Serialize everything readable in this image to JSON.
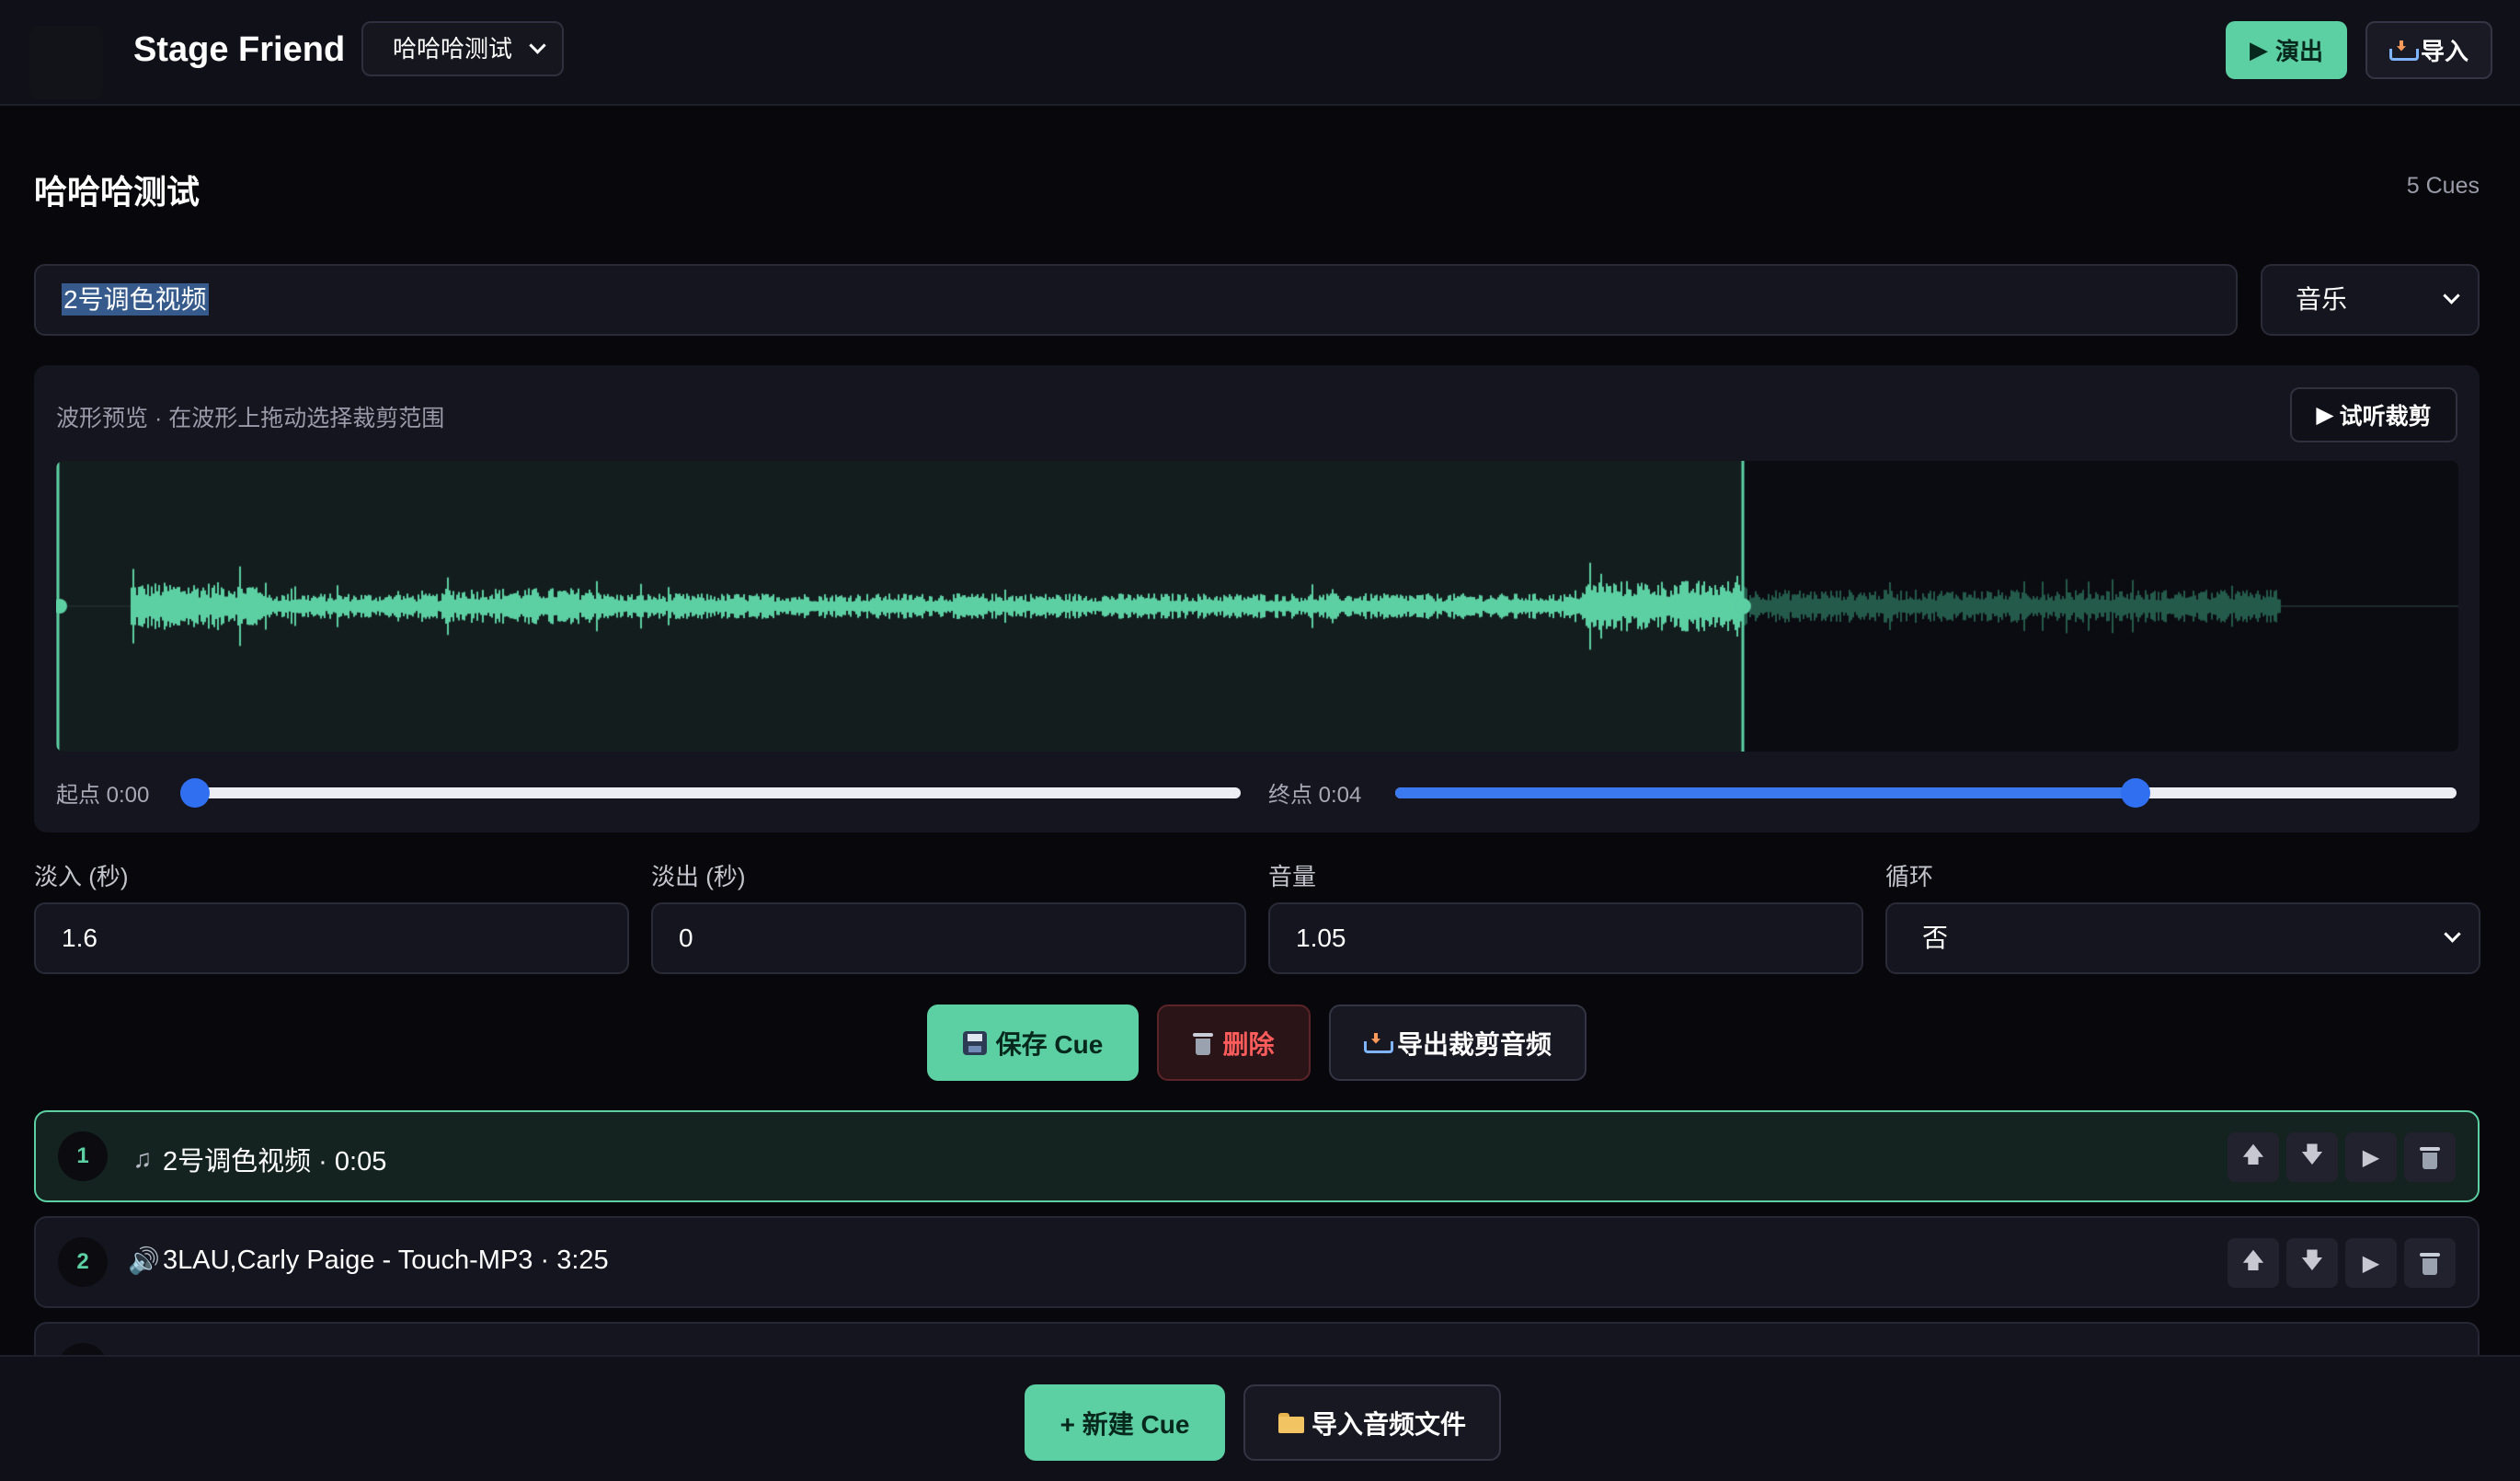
{
  "header": {
    "app_title": "Stage Friend",
    "project_select": "哈哈哈测试",
    "perform_label": "演出",
    "import_label": "导入"
  },
  "editor": {
    "project_title": "哈哈哈测试",
    "cue_count": "5 Cues",
    "name_value": "2号调色视频",
    "type_value": "音乐",
    "waveform_hint": "波形预览 · 在波形上拖动选择裁剪范围",
    "preview_label": "试听裁剪",
    "start_label": "起点 0:00",
    "end_label": "终点 0:04",
    "start_slider_fraction": 0.0,
    "end_slider_fraction": 0.698,
    "selection_fraction": 0.702
  },
  "fields": {
    "fade_in_label": "淡入 (秒)",
    "fade_in_value": "1.6",
    "fade_out_label": "淡出 (秒)",
    "fade_out_value": "0",
    "volume_label": "音量",
    "volume_value": "1.05",
    "loop_label": "循环",
    "loop_value": "否"
  },
  "actions": {
    "save_label": "保存 Cue",
    "delete_label": "删除",
    "export_label": "导出裁剪音频"
  },
  "cues": [
    {
      "num": "1",
      "icon": "music-note-icon",
      "text": "2号调色视频 · 0:05"
    },
    {
      "num": "2",
      "icon": "speaker-icon",
      "text": "3LAU,Carly Paige - Touch-MP3 · 3:25"
    }
  ],
  "bottom": {
    "new_cue_label": "+ 新建 Cue",
    "import_audio_label": "导入音频文件"
  },
  "colors": {
    "accent": "#5ccfa3",
    "danger": "#ff5c5c",
    "slider": "#3b79f0"
  }
}
